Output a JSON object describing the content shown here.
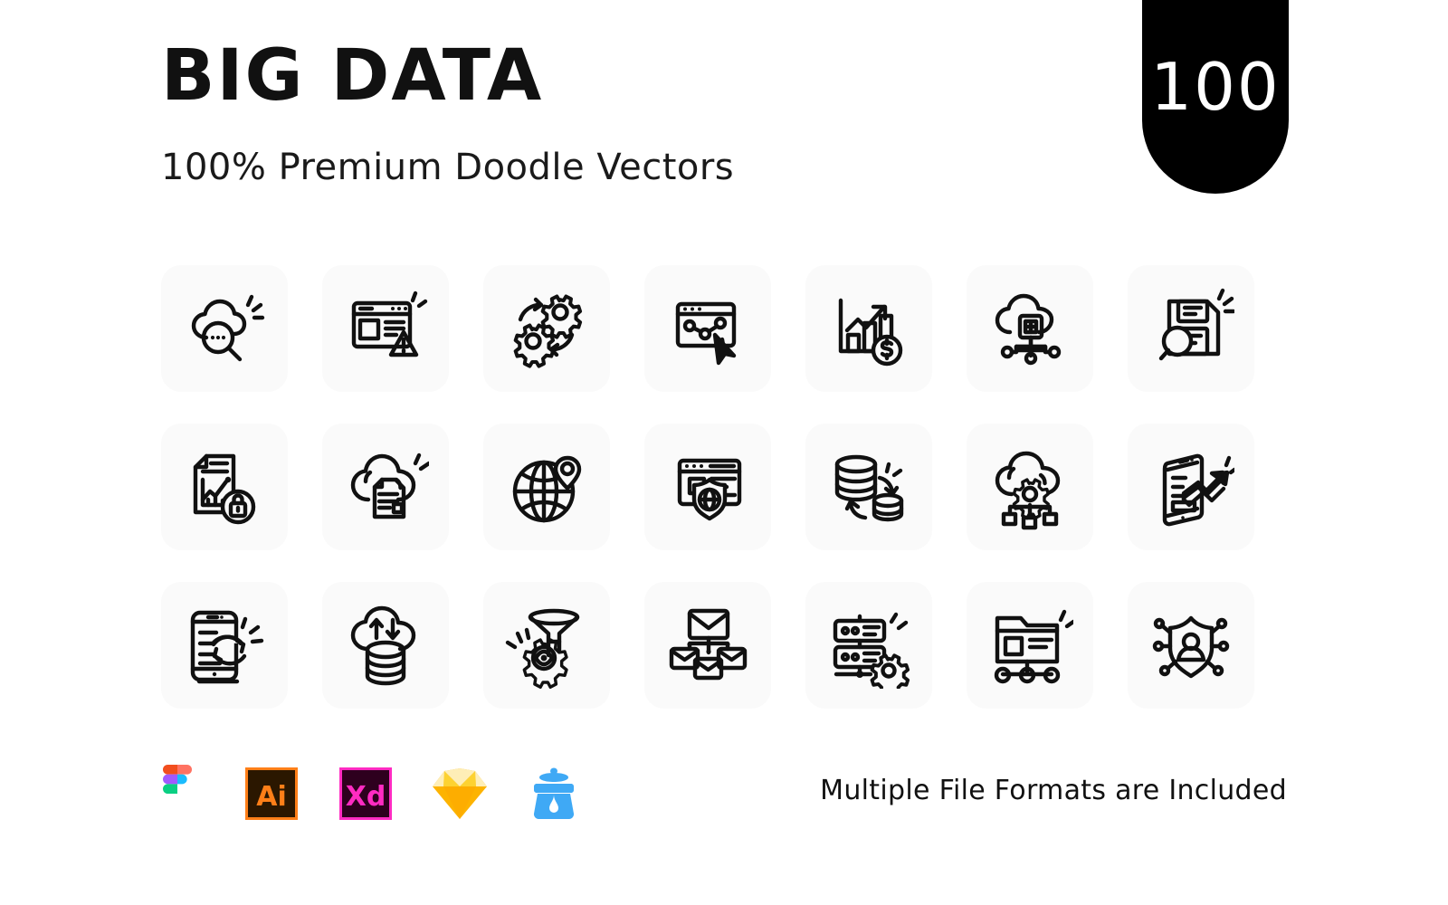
{
  "header": {
    "title": "BIG DATA",
    "subtitle": "100% Premium Doodle Vectors"
  },
  "badge": {
    "count": "100",
    "background": "#000000",
    "text_color": "#ffffff"
  },
  "grid": {
    "columns": 7,
    "rows": 3,
    "tile_background": "#fafafa",
    "stroke_color": "#111111",
    "icons": [
      {
        "name": "cloud-search-icon",
        "label": "Cloud Data Search"
      },
      {
        "name": "browser-warning-icon",
        "label": "Website Error Warning"
      },
      {
        "name": "gears-process-icon",
        "label": "Data Processing Gears"
      },
      {
        "name": "browser-analytics-click-icon",
        "label": "Analytics Click"
      },
      {
        "name": "growth-chart-money-icon",
        "label": "Revenue Growth Chart"
      },
      {
        "name": "cloud-add-network-icon",
        "label": "Cloud Node Add"
      },
      {
        "name": "floppy-search-icon",
        "label": "Storage Search"
      },
      {
        "name": "report-lock-icon",
        "label": "Secure Report"
      },
      {
        "name": "cloud-document-icon",
        "label": "Cloud Document"
      },
      {
        "name": "globe-location-icon",
        "label": "Global Location Data"
      },
      {
        "name": "browser-shield-icon",
        "label": "Web Security"
      },
      {
        "name": "database-sync-icon",
        "label": "Database Migration"
      },
      {
        "name": "cloud-gear-network-icon",
        "label": "Cloud Configuration"
      },
      {
        "name": "mobile-growth-icon",
        "label": "Mobile Analytics"
      },
      {
        "name": "mobile-sync-icon",
        "label": "Mobile Data Sync"
      },
      {
        "name": "cloud-database-transfer-icon",
        "label": "Cloud Database Transfer"
      },
      {
        "name": "funnel-gear-eye-icon",
        "label": "Data Filtering Insight"
      },
      {
        "name": "email-network-icon",
        "label": "Email Distribution"
      },
      {
        "name": "server-gear-icon",
        "label": "Server Configuration"
      },
      {
        "name": "folder-network-icon",
        "label": "Shared Folder Network"
      },
      {
        "name": "shield-user-network-icon",
        "label": "User Data Privacy"
      }
    ]
  },
  "footer": {
    "note": "Multiple File Formats are Included",
    "formats": [
      {
        "name": "figma-logo",
        "label": "Figma",
        "color": "#F24E1E"
      },
      {
        "name": "illustrator-logo",
        "label": "Ai",
        "color": "#FF7F18",
        "bg": "#2B1700"
      },
      {
        "name": "xd-logo",
        "label": "Xd",
        "color": "#FF2BC2",
        "bg": "#2E001E"
      },
      {
        "name": "sketch-logo",
        "label": "Sketch",
        "color": "#FDB300"
      },
      {
        "name": "inkscape-logo",
        "label": "Inkscape",
        "color": "#3FA9F5"
      }
    ]
  }
}
